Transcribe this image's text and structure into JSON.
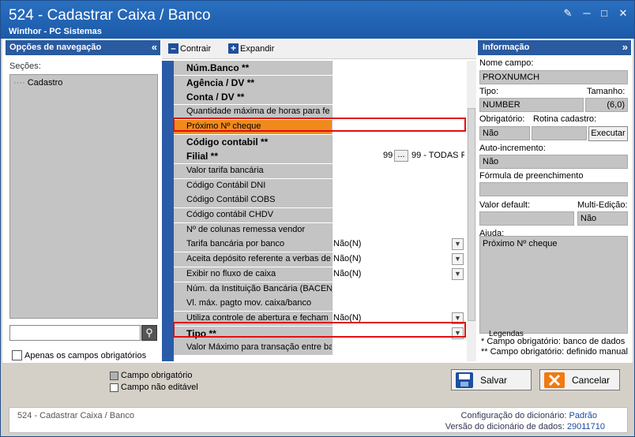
{
  "window": {
    "title": "524 - Cadastrar Caixa / Banco",
    "subtitle": "Winthor - PC Sistemas"
  },
  "nav": {
    "header": "Opções de navegação",
    "sections_label": "Seções:",
    "tree_item": "Cadastro",
    "only_required_label": "Apenas os campos obrigatórios"
  },
  "toolbar": {
    "collapse_label": "Contrair",
    "expand_label": "Expandir"
  },
  "fields": [
    {
      "label": "Núm.Banco **",
      "value": "",
      "bold": true
    },
    {
      "label": "Agência / DV **",
      "value": "",
      "bold": true
    },
    {
      "label": "Conta / DV **",
      "value": "",
      "bold": true
    },
    {
      "label": "Quantidade máxima de horas para fe",
      "value": ""
    },
    {
      "label": "Próximo Nº cheque",
      "value": ""
    },
    {
      "label": "Código contabil **",
      "value": "",
      "bold": true
    },
    {
      "label": "Filial **",
      "value": "99",
      "value2": "99 - TODAS F",
      "bold": true
    },
    {
      "label": "Valor tarifa bancária",
      "value": ""
    },
    {
      "label": "Código Contábil DNI",
      "value": ""
    },
    {
      "label": "Código Contábil COBS",
      "value": ""
    },
    {
      "label": "Código contábil CHDV",
      "value": ""
    },
    {
      "label": "Nº de colunas remessa vendor",
      "value": ""
    },
    {
      "label": "Tarifa bancária por banco",
      "value": "Não(N)"
    },
    {
      "label": "Aceita depósito referente a verbas de",
      "value": "Não(N)"
    },
    {
      "label": "Exibir no fluxo de caixa",
      "value": "Não(N)"
    },
    {
      "label": "Núm. da Instituição Bancária (BACEN",
      "value": ""
    },
    {
      "label": "Vl. máx. pagto mov. caixa/banco",
      "value": ""
    },
    {
      "label": "Utiliza controle de abertura e fecham",
      "value": "Não(N)"
    },
    {
      "label": "Tipo **",
      "value": "",
      "bold": true
    },
    {
      "label": "Valor Máximo para transação entre ba",
      "value": ""
    }
  ],
  "filial_button": "...",
  "info": {
    "header": "Informação",
    "field_name_label": "Nome campo:",
    "field_name": "PROXNUMCH",
    "type_label": "Tipo:",
    "size_label": "Tamanho:",
    "type": "NUMBER",
    "size": "(6,0)",
    "required_label": "Obrigatório:",
    "routine_label": "Rotina cadastro:",
    "required": "Não",
    "execute_label": "Executar",
    "autoinc_label": "Auto-incremento:",
    "autoinc": "Não",
    "formula_label": "Fórmula de preenchimento",
    "default_label": "Valor default:",
    "multi_label": "Multi-Edição:",
    "multi": "Não",
    "help_label": "Ajuda:",
    "help": "Próximo Nº cheque",
    "legend_title": "Legendas",
    "legend1": "* Campo obrigatório: banco de dados",
    "legend2": "** Campo obrigatório: definido manual"
  },
  "bottom": {
    "legend_required": "Campo obrigatório",
    "legend_noneditable": "Campo não editável",
    "save_label": "Salvar",
    "cancel_label": "Cancelar"
  },
  "status": {
    "left": "524 - Cadastrar Caixa / Banco",
    "dict_config_label": "Configuração do dicionário:",
    "dict_config": "Padrão",
    "dict_version_label": "Versão do dicionário de dados:",
    "dict_version": "29011710"
  }
}
